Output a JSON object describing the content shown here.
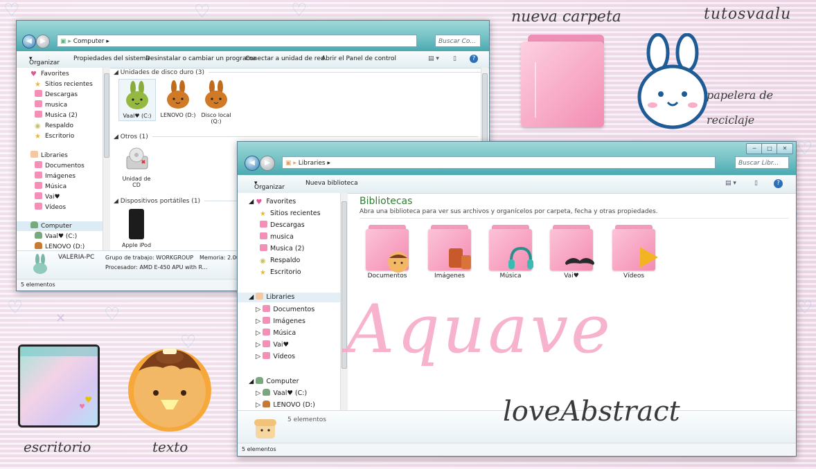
{
  "decor": {
    "nueva_carpeta": "nueva carpeta",
    "tutosvaalu": "tutosvaalu",
    "papelera_1": "papelera de",
    "papelera_2": "reciclaje",
    "escritorio": "escritorio",
    "texto": "texto",
    "aquave": "Aquave",
    "loveabstract": "loveAbstract"
  },
  "computer_window": {
    "address": "Computer",
    "search_placeholder": "Buscar Co...",
    "toolbar": [
      "Organizar",
      "Propiedades del sistema",
      "Desinstalar o cambiar un programa",
      "Conectar a unidad de red",
      "Abrir el Panel de control"
    ],
    "nav": {
      "favorites": "Favorites",
      "fav_items": [
        "Sitios recientes",
        "Descargas",
        "musica",
        "Musica (2)",
        "Respaldo",
        "Escritorio"
      ],
      "libraries": "Libraries",
      "lib_items": [
        "Documentos",
        "Imágenes",
        "Música",
        "Vai♥",
        "Vídeos"
      ],
      "computer": "Computer",
      "comp_items": [
        "Vaal♥ (C:)",
        "LENOVO (D:)"
      ]
    },
    "sections": {
      "hard_drives": "Unidades de disco duro (3)",
      "others": "Otros (1)",
      "portable": "Dispositivos portátiles (1)"
    },
    "drives": [
      "Vaal♥ (C:)",
      "LENOVO (D:)",
      "Disco local (Q:)"
    ],
    "cd": "Unidad de CD",
    "ipod": "Apple iPod",
    "details": {
      "pc_name": "VALERIA-PC",
      "workgroup": "Grupo de trabajo: WORKGROUP",
      "memory": "Memoria: 2.00",
      "processor": "Procesador: AMD E-450 APU with R..."
    },
    "status": "5 elementos"
  },
  "libraries_window": {
    "address": "Libraries",
    "search_placeholder": "Buscar Libr...",
    "toolbar": [
      "Organizar",
      "Nueva biblioteca"
    ],
    "nav": {
      "favorites": "Favorites",
      "fav_items": [
        "Sitios recientes",
        "Descargas",
        "musica",
        "Musica (2)",
        "Respaldo",
        "Escritorio"
      ],
      "libraries": "Libraries",
      "lib_items": [
        "Documentos",
        "Imágenes",
        "Música",
        "Vai♥",
        "Vídeos"
      ],
      "computer": "Computer",
      "comp_items": [
        "Vaal♥ (C:)",
        "LENOVO (D:)"
      ]
    },
    "heading": "Bibliotecas",
    "subheading": "Abra una biblioteca para ver sus archivos y organícelos por carpeta, fecha y otras propiedades.",
    "libraries": [
      "Documentos",
      "Imágenes",
      "Música",
      "Vai♥",
      "Vídeos"
    ],
    "details_count": "5 elementos",
    "status": "5 elementos"
  },
  "colors": {
    "accent_teal": "#4aa9b0",
    "folder_pink": "#f48cb2",
    "heading_green": "#2e7d32"
  }
}
